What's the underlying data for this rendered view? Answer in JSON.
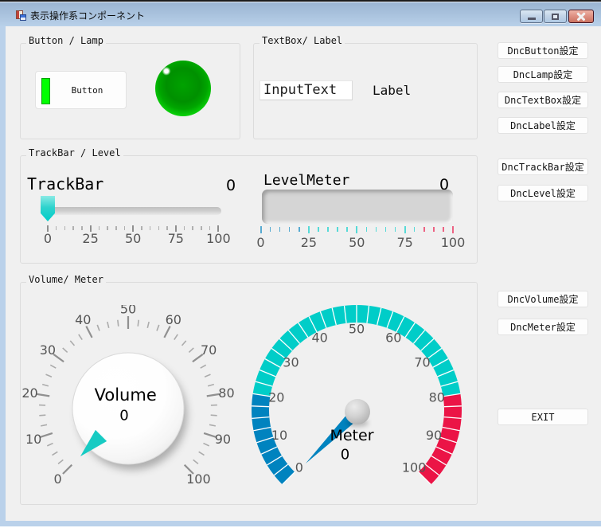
{
  "window": {
    "title": "表示操作系コンポーネント"
  },
  "groups": {
    "button_lamp": {
      "title": "Button / Lamp",
      "button_label": "Button"
    },
    "textbox_label": {
      "title": "TextBox/ Label",
      "textbox_value": "InputText",
      "label_text": "Label"
    },
    "trackbar_level": {
      "title": "TrackBar / Level",
      "trackbar": {
        "title": "TrackBar",
        "value": "0",
        "min": 0,
        "max": 100,
        "minor_step": 5,
        "major_step": 25,
        "scale_labels": [
          "0",
          "25",
          "50",
          "75",
          "100"
        ],
        "minor_color": "#b0b0b0",
        "major_color": "#8f8f8f"
      },
      "levelmeter": {
        "title": "LevelMeter",
        "value": "0",
        "min": 0,
        "max": 100,
        "minor_step": 5,
        "major_step": 25,
        "scale_labels": [
          "0",
          "25",
          "50",
          "75",
          "100"
        ],
        "low_max": 20,
        "high_min": 85,
        "tick_colors": {
          "low": "#56aad1",
          "mid": "#56dad7",
          "high": "#ed6383"
        }
      }
    },
    "volume_meter": {
      "title": "Volume/ Meter",
      "volume": {
        "title": "Volume",
        "value": "0",
        "min": 0,
        "max": 100,
        "minor_step": 2.5,
        "major_step": 10,
        "scale_labels": [
          "0",
          "10",
          "20",
          "30",
          "40",
          "50",
          "60",
          "70",
          "80",
          "90",
          "100"
        ],
        "pointer_color": "#17cbc3"
      },
      "meter": {
        "title": "Meter",
        "value": "0",
        "min": 0,
        "max": 100,
        "segment_step": 2.5,
        "scale_labels": [
          "0",
          "10",
          "20",
          "30",
          "40",
          "50",
          "60",
          "70",
          "80",
          "90",
          "100"
        ],
        "zones": [
          {
            "to": 20,
            "color": "#0083bf"
          },
          {
            "to": 80,
            "color": "#00cdc8"
          },
          {
            "to": 100,
            "color": "#eb1446"
          }
        ],
        "needle_color": "#0083bf"
      }
    }
  },
  "side_buttons": [
    {
      "label": "DncButton設定"
    },
    {
      "label": "DncLamp設定"
    },
    {
      "label": "DncTextBox設定"
    },
    {
      "label": "DncLabel設定"
    },
    {
      "label": "DncTrackBar設定"
    },
    {
      "label": "DncLevel設定"
    },
    {
      "label": "DncVolume設定"
    },
    {
      "label": "DncMeter設定"
    }
  ],
  "exit_button": {
    "label": "EXIT"
  }
}
